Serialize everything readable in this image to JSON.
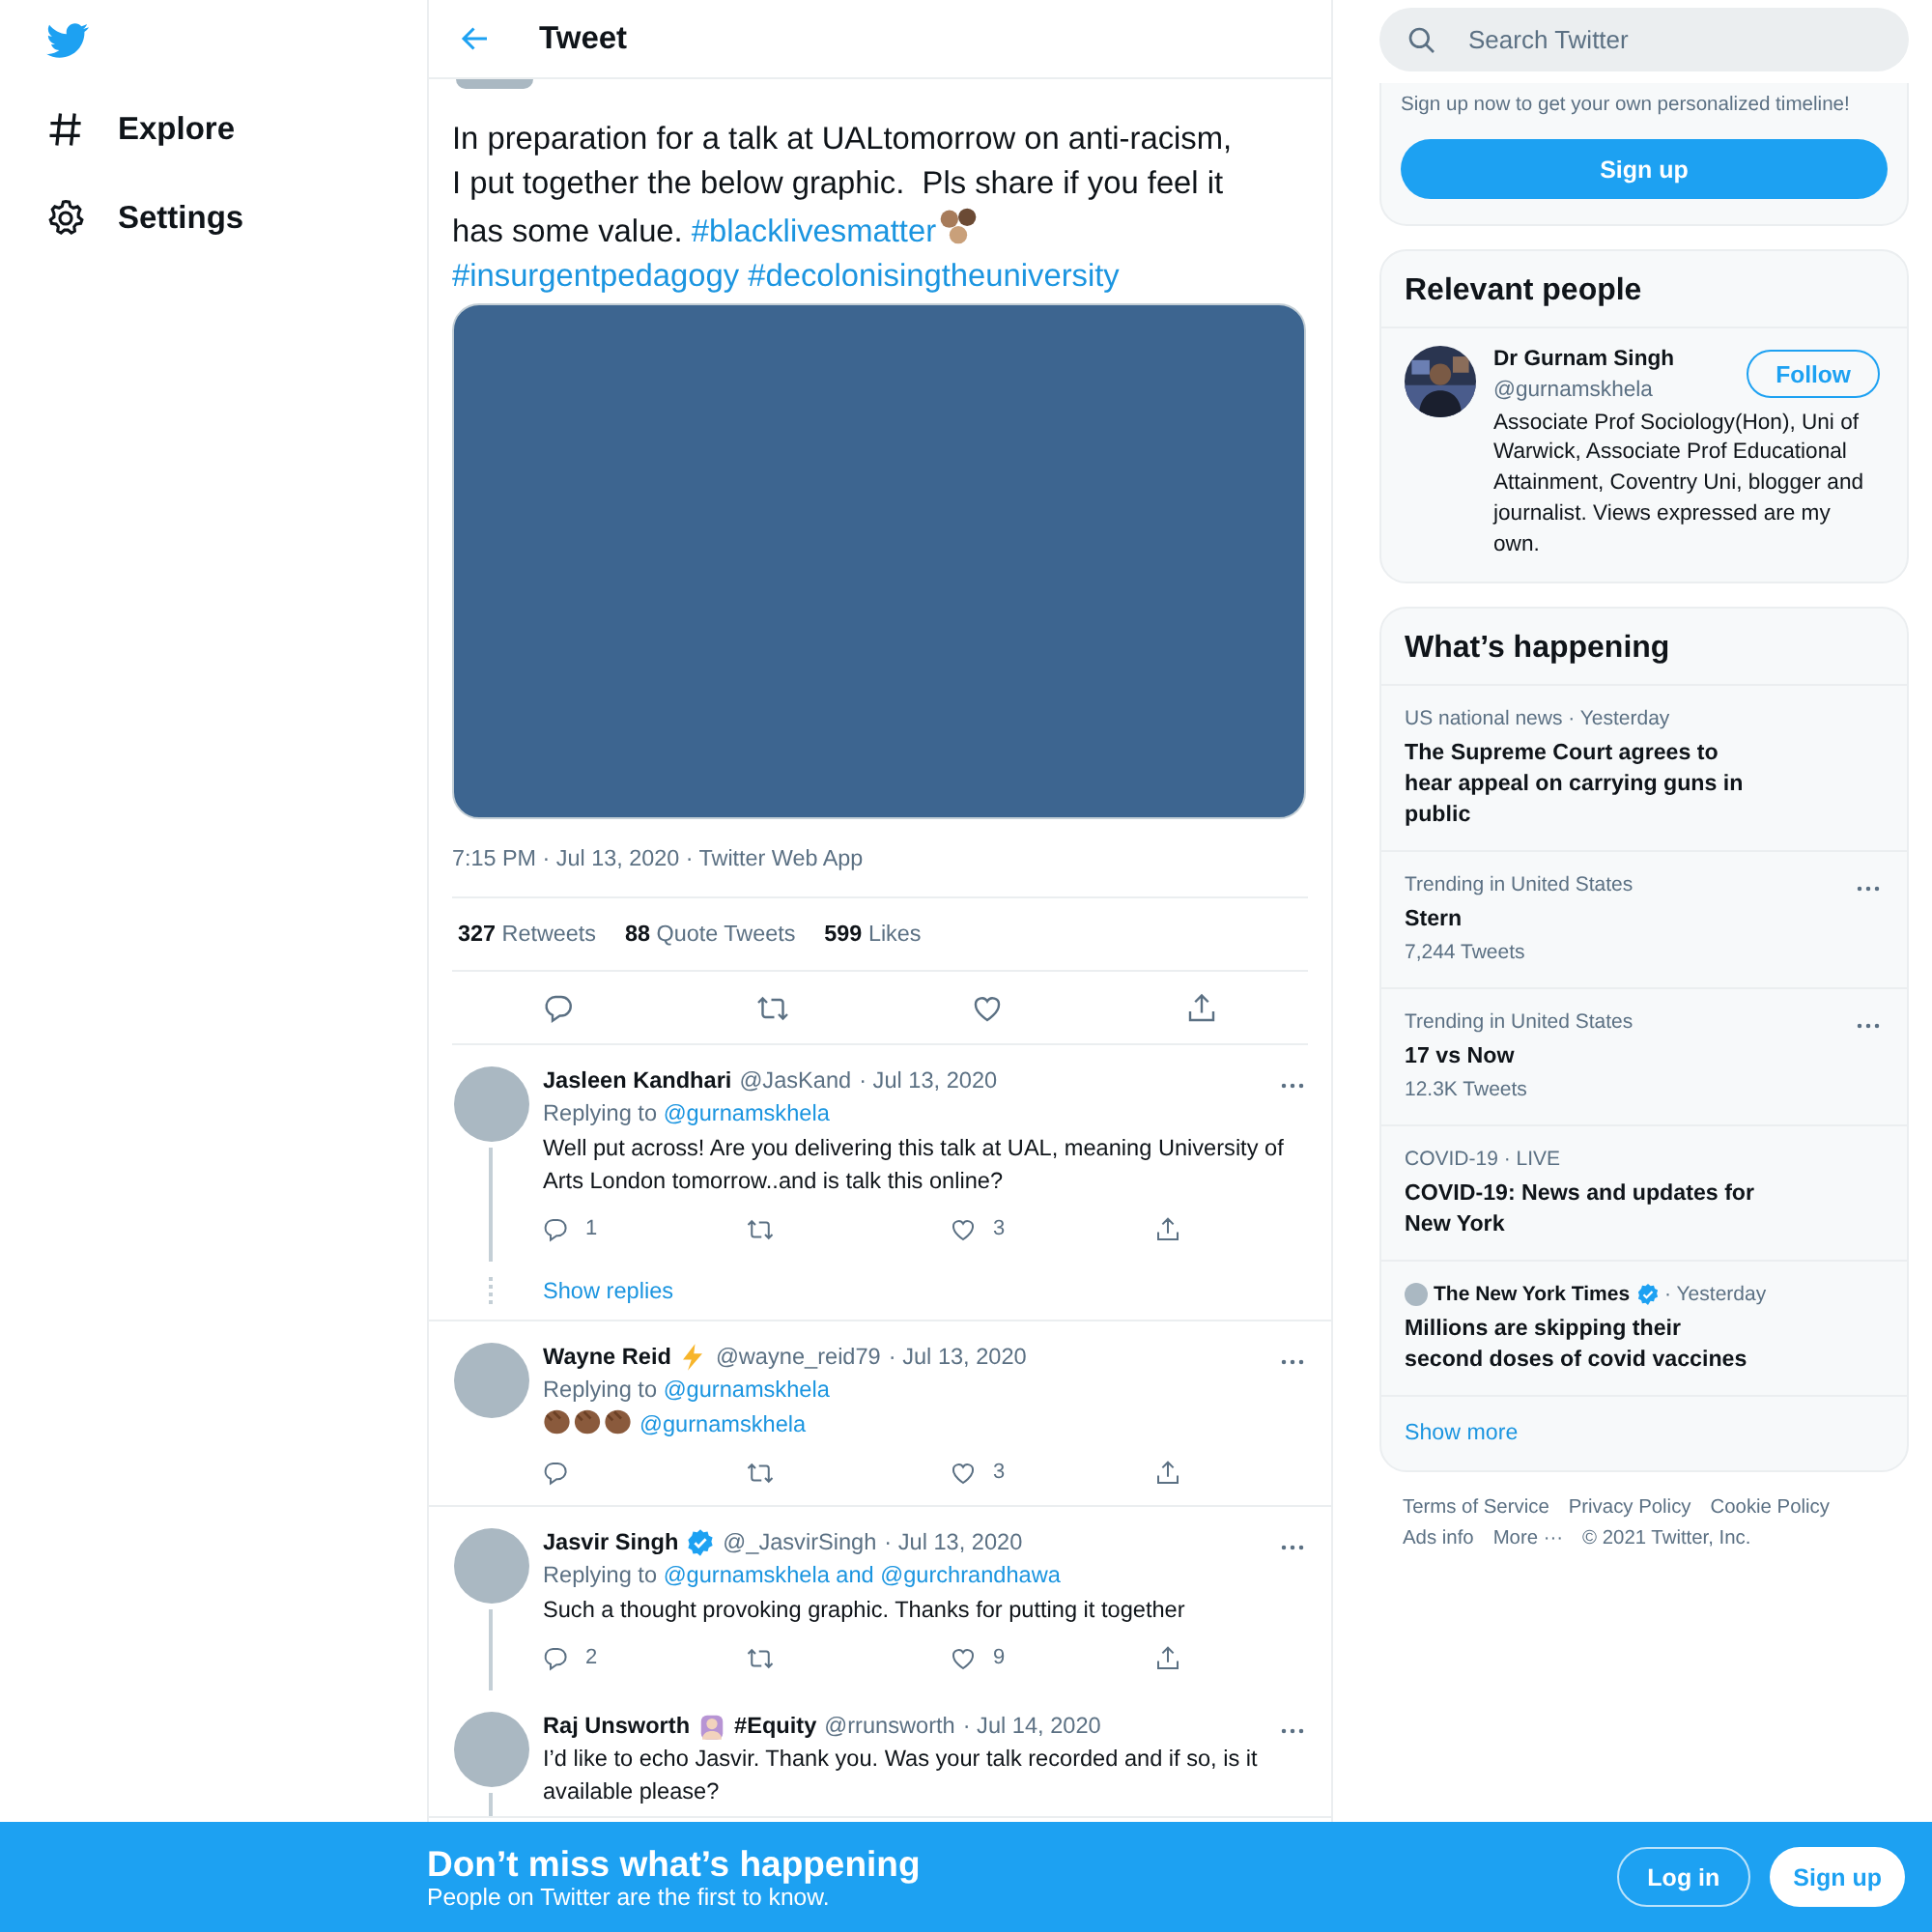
{
  "nav": {
    "items": [
      {
        "label": "Explore"
      },
      {
        "label": "Settings"
      }
    ]
  },
  "header": {
    "title": "Tweet"
  },
  "tweet": {
    "text": "In preparation for a talk at UALtomorrow on anti-racism, I put together the below graphic.  Pls share if you feel it has some value.",
    "hashtags": [
      {
        "text": "#blacklivesmatter",
        "emoji": true
      },
      {
        "text": "#insurgentpedagogy",
        "emoji": false
      },
      {
        "text": "#decolonisingtheuniversity",
        "emoji": false
      }
    ],
    "meta": "7:15 PM · Jul 13, 2020 · Twitter Web App",
    "stats": [
      {
        "count": "327",
        "label": "Retweets"
      },
      {
        "count": "88",
        "label": "Quote Tweets"
      },
      {
        "count": "599",
        "label": "Likes"
      }
    ]
  },
  "replies": [
    {
      "name": "Jasleen Kandhari",
      "kind": "plain",
      "handle": "@JasKand",
      "date": "· Jul 13, 2020",
      "replying_label": "Replying to",
      "replying_to": "@gurnamskhela",
      "text": "Well put across! Are you delivering this talk at UAL, meaning University of Arts London tomorrow..and is talk this online?",
      "actions": {
        "reply": "1",
        "like": "3"
      },
      "thread_line": true,
      "show_replies": "Show replies"
    },
    {
      "name": "Wayne Reid",
      "kind": "lightning",
      "handle": "@wayne_reid79",
      "date": "· Jul 13, 2020",
      "replying_label": "Replying to",
      "replying_to": "@gurnamskhela",
      "clap_emoji": true,
      "mention": "@gurnamskhela",
      "actions": {
        "like": "3"
      },
      "thread_line": false
    },
    {
      "name": "Jasvir Singh",
      "kind": "verified",
      "handle": "@_JasvirSingh",
      "date": "· Jul 13, 2020",
      "replying_label": "Replying to",
      "replying_to": "@gurnamskhela and @gurchrandhawa",
      "text": "Such a thought provoking graphic. Thanks for putting it together",
      "actions": {
        "reply": "2",
        "like": "9"
      },
      "thread_line": true
    },
    {
      "name": "Raj Unsworth",
      "kind": "emoji",
      "name_suffix": "#Equity",
      "handle": "@rrunsworth",
      "date": "· Jul 14, 2020",
      "text": "I’d like to echo Jasvir. Thank you. Was your talk recorded and if so, is it available please?",
      "thread_line": true
    }
  ],
  "search": {
    "placeholder": "Search Twitter"
  },
  "signup_card": {
    "text": "Sign up now to get your own personalized timeline!",
    "button": "Sign up"
  },
  "relevant_people": {
    "title": "Relevant people",
    "person": {
      "name": "Dr Gurnam Singh",
      "handle": "@gurnamskhela",
      "bio": "Associate Prof Sociology(Hon), Uni of Warwick, Associate Prof Educational Attainment, Coventry Uni, blogger and journalist. Views expressed are my own.",
      "follow": "Follow"
    }
  },
  "trends": {
    "title": "What’s happening",
    "items": [
      {
        "kind": "news",
        "context": "US national news · Yesterday",
        "title": "The Supreme Court agrees to hear appeal on carrying guns in public"
      },
      {
        "kind": "trend",
        "context": "Trending in United States",
        "title": "Stern",
        "count": "7,244 Tweets"
      },
      {
        "kind": "trend",
        "context": "Trending in United States",
        "title": "17 vs Now",
        "count": "12.3K Tweets"
      },
      {
        "kind": "news",
        "context": "COVID-19 · LIVE",
        "title": "COVID-19: News and updates for New York"
      },
      {
        "kind": "source",
        "source": "The New York Times",
        "context": "· Yesterday",
        "title": "Millions are skipping their second doses of covid vaccines"
      }
    ],
    "show_more": "Show more"
  },
  "footer": {
    "links": [
      "Terms of Service",
      "Privacy Policy",
      "Cookie Policy",
      "Ads info",
      "More ···"
    ],
    "copyright": "© 2021 Twitter, Inc."
  },
  "banner": {
    "title": "Don’t miss what’s happening",
    "subtitle": "People on Twitter are the first to know.",
    "login": "Log in",
    "signup": "Sign up"
  }
}
